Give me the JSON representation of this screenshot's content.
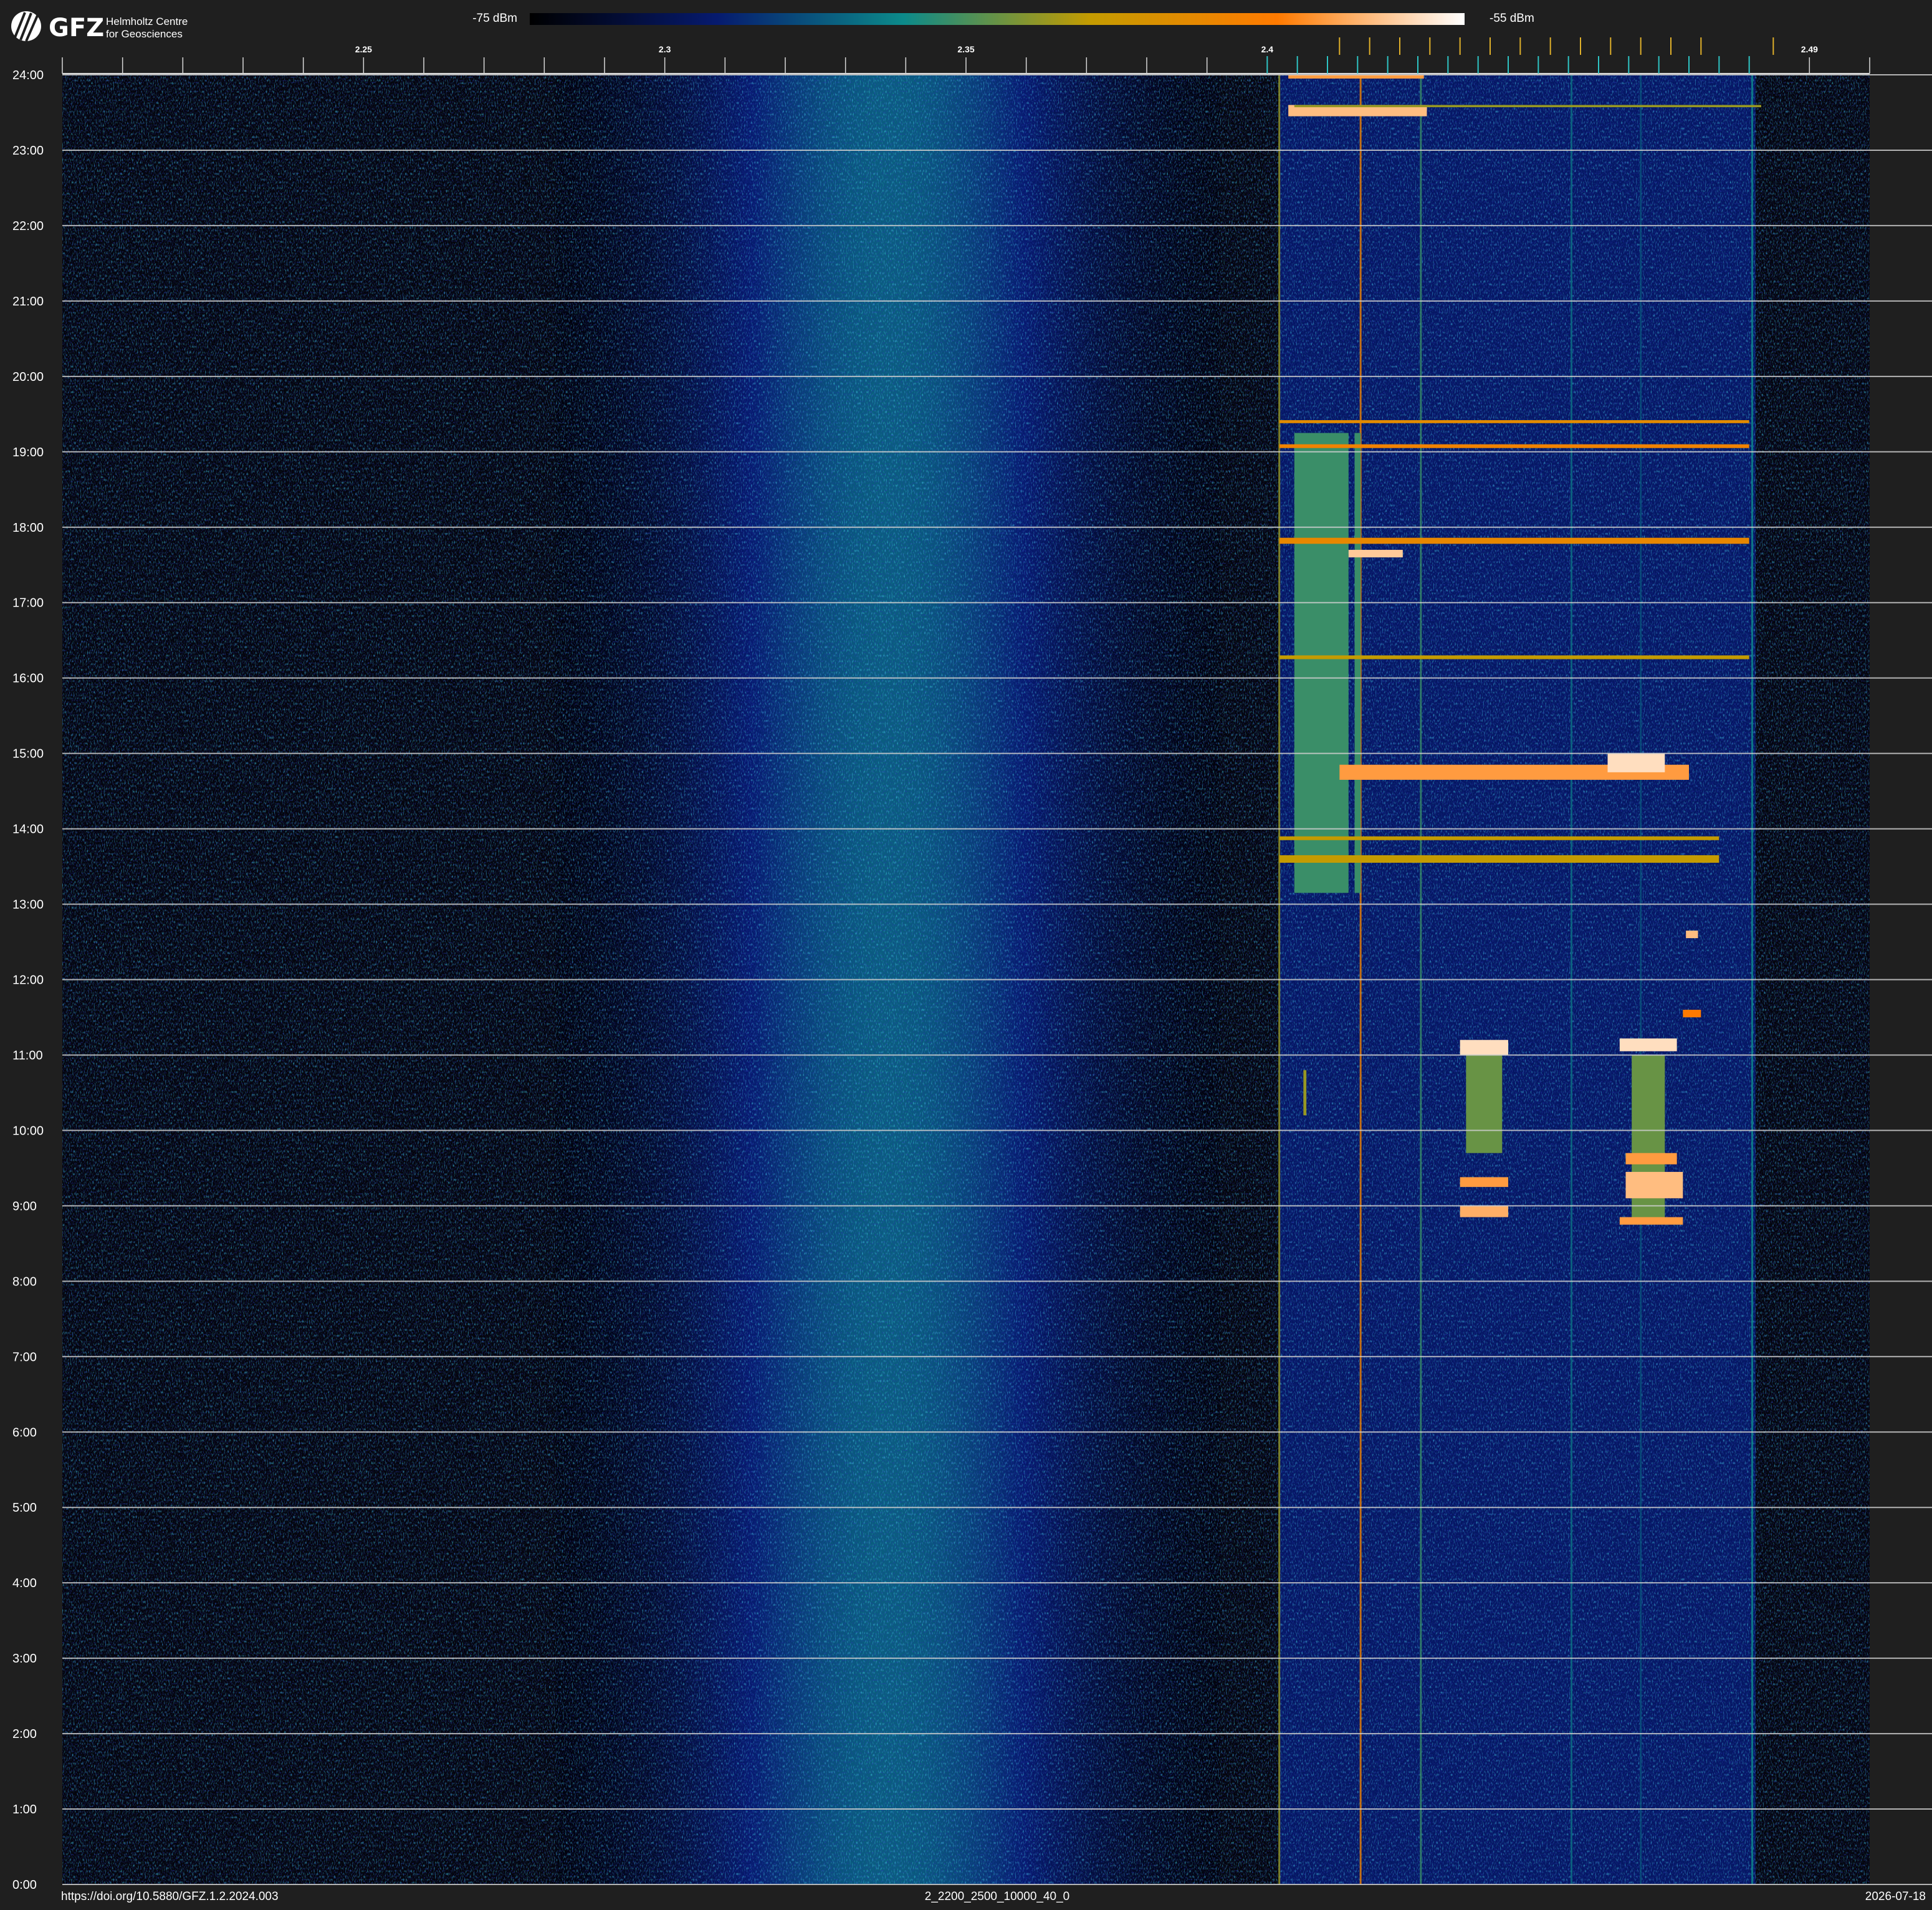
{
  "logo": {
    "wordmark": "GFZ",
    "line1": "Helmholtz Centre",
    "line2": "for Geosciences"
  },
  "colorbar": {
    "min_label": "-75 dBm",
    "max_label": "-55 dBm",
    "min_dbm": -75,
    "max_dbm": -55,
    "colors": [
      "#000000",
      "#061a6e",
      "#0c8a8a",
      "#c49b00",
      "#ff7a00",
      "#ffffff"
    ]
  },
  "footer": {
    "doi": "https://doi.org/10.5880/GFZ.1.2.2024.003",
    "file_id": "2_2200_2500_10000_40_0",
    "date": "2026-07-18"
  },
  "chart_data": {
    "type": "heatmap",
    "title": "",
    "xlabel": "",
    "ylabel": "",
    "xlim": [
      2.2,
      2.5
    ],
    "ylim": [
      0,
      24
    ],
    "x_tick_labels": [
      {
        "value": 2.25,
        "label": "2.25"
      },
      {
        "value": 2.3,
        "label": "2.3"
      },
      {
        "value": 2.35,
        "label": "2.35"
      },
      {
        "value": 2.4,
        "label": "2.4"
      },
      {
        "value": 2.49,
        "label": "2.49"
      }
    ],
    "x_minor_step": 0.01,
    "channel_markers": [
      2.4,
      2.405,
      2.41,
      2.415,
      2.42,
      2.425,
      2.43,
      2.435,
      2.44,
      2.445,
      2.45,
      2.455,
      2.46,
      2.465,
      2.47,
      2.475,
      2.48
    ],
    "wifi_channel_markers": [
      2.412,
      2.417,
      2.422,
      2.427,
      2.432,
      2.437,
      2.442,
      2.447,
      2.452,
      2.457,
      2.462,
      2.467,
      2.472,
      2.484
    ],
    "y_ticks": [
      "0:00",
      "1:00",
      "2:00",
      "3:00",
      "4:00",
      "5:00",
      "6:00",
      "7:00",
      "8:00",
      "9:00",
      "10:00",
      "11:00",
      "12:00",
      "13:00",
      "14:00",
      "15:00",
      "16:00",
      "17:00",
      "18:00",
      "19:00",
      "20:00",
      "21:00",
      "22:00",
      "23:00",
      "24:00"
    ],
    "bands": [
      {
        "name": "broadband noise",
        "center": 2.337,
        "fwhm": 0.055,
        "level": 0.32
      },
      {
        "name": "ism-band activity",
        "from": 2.402,
        "to": 2.481,
        "level": 0.18
      }
    ],
    "events": [
      {
        "f0": 2.4035,
        "f1": 2.4265,
        "t0": 23.45,
        "t1": 23.6,
        "level": 0.9
      },
      {
        "f0": 2.4035,
        "f1": 2.426,
        "t0": 23.95,
        "t1": 24.0,
        "level": 0.85
      },
      {
        "f0": 2.4045,
        "f1": 2.4135,
        "t0": 13.15,
        "t1": 19.25,
        "level": 0.45
      },
      {
        "f0": 2.4145,
        "f1": 2.4155,
        "t0": 13.15,
        "t1": 19.25,
        "level": 0.45
      },
      {
        "f0": 2.4135,
        "f1": 2.4225,
        "t0": 17.6,
        "t1": 17.7,
        "level": 0.92
      },
      {
        "f0": 2.402,
        "f1": 2.48,
        "t0": 19.05,
        "t1": 19.1,
        "level": 0.75
      },
      {
        "f0": 2.402,
        "f1": 2.48,
        "t0": 19.38,
        "t1": 19.42,
        "level": 0.7
      },
      {
        "f0": 2.402,
        "f1": 2.48,
        "t0": 17.78,
        "t1": 17.86,
        "level": 0.72
      },
      {
        "f0": 2.402,
        "f1": 2.48,
        "t0": 16.25,
        "t1": 16.3,
        "level": 0.6
      },
      {
        "f0": 2.412,
        "f1": 2.47,
        "t0": 14.65,
        "t1": 14.85,
        "level": 0.85
      },
      {
        "f0": 2.4565,
        "f1": 2.466,
        "t0": 14.75,
        "t1": 15.0,
        "level": 0.95
      },
      {
        "f0": 2.432,
        "f1": 2.44,
        "t0": 11.0,
        "t1": 11.2,
        "level": 0.95
      },
      {
        "f0": 2.4585,
        "f1": 2.468,
        "t0": 11.05,
        "t1": 11.22,
        "level": 0.95
      },
      {
        "f0": 2.433,
        "f1": 2.439,
        "t0": 9.7,
        "t1": 11.0,
        "level": 0.5
      },
      {
        "f0": 2.4605,
        "f1": 2.466,
        "t0": 8.8,
        "t1": 11.0,
        "level": 0.5
      },
      {
        "f0": 2.432,
        "f1": 2.44,
        "t0": 8.85,
        "t1": 9.0,
        "level": 0.88
      },
      {
        "f0": 2.432,
        "f1": 2.44,
        "t0": 9.25,
        "t1": 9.38,
        "level": 0.85
      },
      {
        "f0": 2.4585,
        "f1": 2.469,
        "t0": 8.75,
        "t1": 8.85,
        "level": 0.85
      },
      {
        "f0": 2.4595,
        "f1": 2.469,
        "t0": 9.1,
        "t1": 9.45,
        "level": 0.9
      },
      {
        "f0": 2.4595,
        "f1": 2.468,
        "t0": 9.55,
        "t1": 9.7,
        "level": 0.85
      },
      {
        "f0": 2.4695,
        "f1": 2.4715,
        "t0": 12.55,
        "t1": 12.65,
        "level": 0.9
      },
      {
        "f0": 2.469,
        "f1": 2.472,
        "t0": 11.5,
        "t1": 11.6,
        "level": 0.8
      },
      {
        "f0": 2.402,
        "f1": 2.475,
        "t0": 13.55,
        "t1": 13.65,
        "level": 0.6
      },
      {
        "f0": 2.402,
        "f1": 2.475,
        "t0": 13.85,
        "t1": 13.9,
        "level": 0.6
      },
      {
        "f0": 2.406,
        "f1": 2.4065,
        "t0": 10.2,
        "t1": 10.8,
        "level": 0.55
      },
      {
        "f0": 2.4045,
        "f1": 2.482,
        "t0": 23.57,
        "t1": 23.6,
        "level": 0.55
      }
    ],
    "stripes": [
      {
        "f": 2.402,
        "level": 0.55
      },
      {
        "f": 2.4155,
        "level": 0.75
      },
      {
        "f": 2.4255,
        "level": 0.45
      },
      {
        "f": 2.4505,
        "level": 0.35
      },
      {
        "f": 2.462,
        "level": 0.3
      },
      {
        "f": 2.4805,
        "level": 0.4
      }
    ]
  }
}
